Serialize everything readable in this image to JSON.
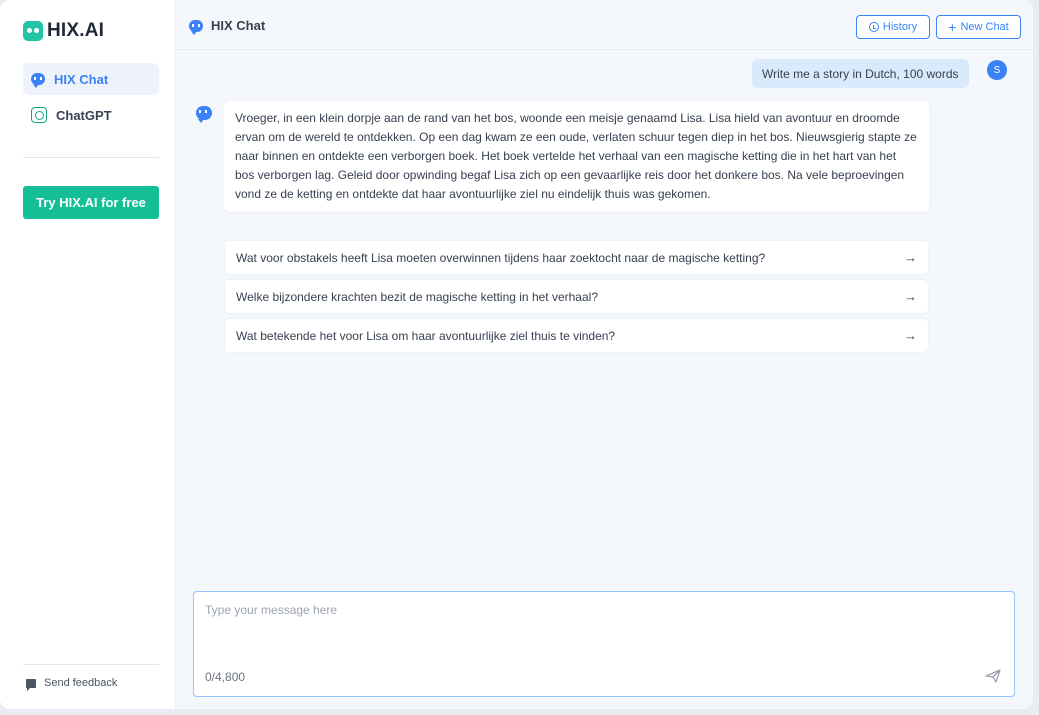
{
  "brand": {
    "name": "HIX.AI"
  },
  "sidebar": {
    "items": [
      {
        "label": "HIX Chat",
        "icon": "chat-bubble-icon",
        "active": true
      },
      {
        "label": "ChatGPT",
        "icon": "chatgpt-icon",
        "active": false
      }
    ],
    "cta_label": "Try HIX.AI for free",
    "feedback_label": "Send feedback"
  },
  "header": {
    "title": "HIX Chat",
    "history_label": "History",
    "new_chat_label": "New Chat"
  },
  "conversation": {
    "user_message": "Write me a story in Dutch, 100 words",
    "user_initial": "S",
    "bot_message": "Vroeger, in een klein dorpje aan de rand van het bos, woonde een meisje genaamd Lisa. Lisa hield van avontuur en droomde ervan om de wereld te ontdekken. Op een dag kwam ze een oude, verlaten schuur tegen diep in het bos. Nieuwsgierig stapte ze naar binnen en ontdekte een verborgen boek. Het boek vertelde het verhaal van een magische ketting die in het hart van het bos verborgen lag. Geleid door opwinding begaf Lisa zich op een gevaarlijke reis door het donkere bos. Na vele beproevingen vond ze de ketting en ontdekte dat haar avontuurlijke ziel nu eindelijk thuis was gekomen.",
    "suggestions": [
      "Wat voor obstakels heeft Lisa moeten overwinnen tijdens haar zoektocht naar de magische ketting?",
      "Welke bijzondere krachten bezit de magische ketting in het verhaal?",
      "Wat betekende het voor Lisa om haar avontuurlijke ziel thuis te vinden?"
    ]
  },
  "composer": {
    "placeholder": "Type your message here",
    "counter": "0/4,800"
  },
  "colors": {
    "accent": "#3b82f6",
    "brand": "#14bf98",
    "user_bubble": "#d8eafb"
  }
}
